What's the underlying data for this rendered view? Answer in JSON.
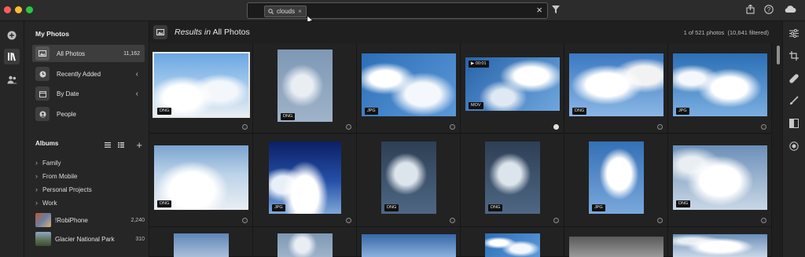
{
  "search": {
    "chip": "clouds",
    "chip_close": "×",
    "clear": "×"
  },
  "sidebar": {
    "my_photos_heading": "My Photos",
    "items": [
      {
        "label": "All Photos",
        "count": "11,162"
      },
      {
        "label": "Recently Added"
      },
      {
        "label": "By Date"
      },
      {
        "label": "People"
      }
    ],
    "albums_heading": "Albums",
    "albums": [
      {
        "label": "Family"
      },
      {
        "label": "From Mobile"
      },
      {
        "label": "Personal Projects"
      },
      {
        "label": "Work"
      }
    ],
    "photo_albums": [
      {
        "label": "!RobiPhone",
        "count": "2,240"
      },
      {
        "label": "Glacier National Park",
        "count": "310"
      }
    ]
  },
  "main": {
    "title_prefix": "Results in",
    "title_scope": "All Photos",
    "summary": "1 of 521 photos  (10,641 filtered)"
  },
  "grid": [
    {
      "badge": "DNG"
    },
    {
      "badge": "DNG"
    },
    {
      "badge": "JPG"
    },
    {
      "badge": "MOV",
      "duration": "▶ 00:01"
    },
    {
      "badge": "DNG"
    },
    {
      "badge": "JPG"
    },
    {
      "badge": "DNG"
    },
    {
      "badge": "JPG"
    },
    {
      "badge": "DNG"
    },
    {
      "badge": "DNG"
    },
    {
      "badge": "JPG"
    },
    {
      "badge": "DNG"
    }
  ]
}
